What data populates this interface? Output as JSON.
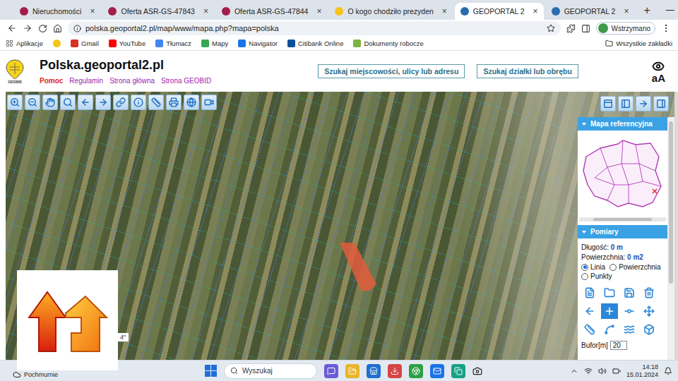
{
  "browser": {
    "tabs": [
      {
        "label": "Nieruchomości",
        "selected": false,
        "color": "#a51d4a"
      },
      {
        "label": "Oferta ASR-GS-47843",
        "selected": false,
        "color": "#a51d4a"
      },
      {
        "label": "Oferta ASR-GS-47844",
        "selected": false,
        "color": "#a51d4a"
      },
      {
        "label": "O kogo chodziło prezyden",
        "selected": false,
        "color": "#f5c518"
      },
      {
        "label": "GEOPORTAL 2",
        "selected": true,
        "color": "#2b6cb0"
      },
      {
        "label": "GEOPORTAL 2",
        "selected": false,
        "color": "#2b6cb0"
      }
    ],
    "tab_close": "×",
    "new_tab": "+",
    "window_controls": [
      "—",
      "❐",
      "✕"
    ],
    "url": "polska.geoportal2.pl/map/www/mapa.php?mapa=polska",
    "profile": "Wstrzymano",
    "bookmarks": [
      {
        "kind": "link",
        "label": "Aplikacje",
        "color": "#5f6368"
      },
      {
        "kind": "icon",
        "color": "#f5c518"
      },
      {
        "kind": "link",
        "label": "Gmail",
        "color": "#d93025"
      },
      {
        "kind": "link",
        "label": "YouTube",
        "color": "#ff0000"
      },
      {
        "kind": "link",
        "label": "Tłumacz",
        "color": "#4285f4"
      },
      {
        "kind": "link",
        "label": "Mapy",
        "color": "#34a853"
      },
      {
        "kind": "link",
        "label": "Navigator",
        "color": "#1a73e8"
      },
      {
        "kind": "link",
        "label": "Citibank Online",
        "color": "#0a4f9c"
      },
      {
        "kind": "link",
        "label": "Dokumenty robocze",
        "color": "#7cb342"
      }
    ],
    "all_bookmarks": "Wszystkie zakładki"
  },
  "page": {
    "logo": "GEOBID",
    "title": "Polska.geoportal2.pl",
    "links": [
      {
        "label": "Pomoc",
        "color": "#e0261b"
      },
      {
        "label": "Regulamin",
        "color": "#9b27af"
      },
      {
        "label": "Strona główna",
        "color": "#9b27af"
      },
      {
        "label": "Strona GEOBID",
        "color": "#9b27af"
      }
    ],
    "search_buttons": [
      "Szukaj miejscowości, ulicy lub adresu",
      "Szukaj działki lub obrębu"
    ],
    "font_size_button": "aA"
  },
  "map": {
    "highlighted_parcel": true,
    "scale_label": "4\""
  },
  "panel": {
    "sections": [
      {
        "title": "Mapa referencyjna",
        "expanded": true
      },
      {
        "title": "Pomiary",
        "expanded": true
      }
    ],
    "measurements": [
      {
        "label": "Długość:",
        "value": "0 m"
      },
      {
        "label": "Powierzchnia:",
        "value": "0 m2"
      }
    ],
    "modes": [
      {
        "label": "Linia",
        "selected": true
      },
      {
        "label": "Powierzchnia",
        "selected": false
      },
      {
        "label": "Punkty",
        "selected": false
      }
    ],
    "tools": [
      {
        "selected": false
      },
      {
        "selected": false
      },
      {
        "selected": false
      },
      {
        "selected": false
      },
      {
        "selected": false
      },
      {
        "selected": true
      },
      {
        "selected": false
      },
      {
        "selected": false
      },
      {
        "selected": false
      },
      {
        "selected": false
      },
      {
        "selected": false
      },
      {
        "selected": false
      }
    ],
    "buffer_label": "Bufor[m]",
    "buffer": "20"
  },
  "taskbar": {
    "weather": "Pochmurnie",
    "search_placeholder": "Wyszukaj",
    "time": "14:18",
    "date": "15.01.2024"
  }
}
